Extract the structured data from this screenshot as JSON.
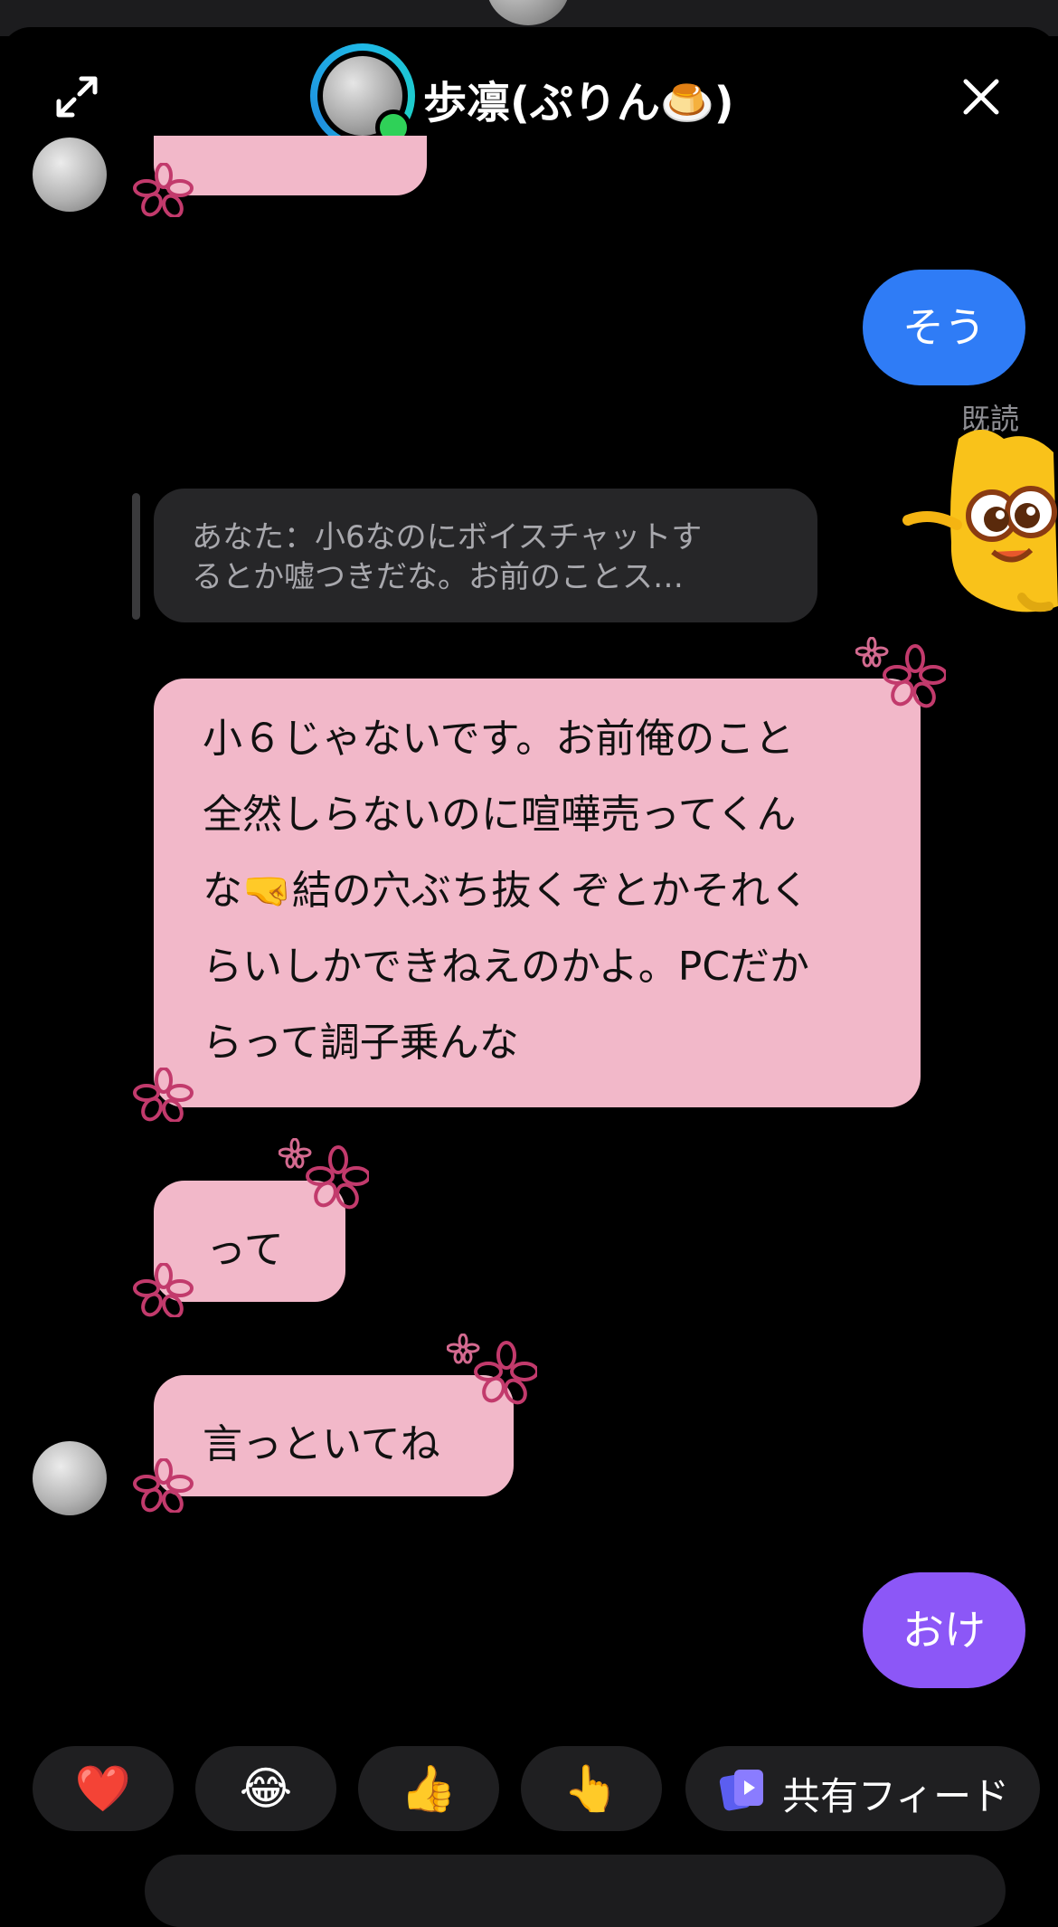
{
  "header": {
    "title": "歩凛(ぷりん🍮)"
  },
  "messages": {
    "sent_1": "そう",
    "read_receipt": "既読",
    "reply_preview": {
      "line1": "あなた：小6なのにボイスチャットす",
      "line2": "るとか嘘つきだな。お前のことス…"
    },
    "received_long": {
      "line1": "小６じゃないです。お前俺のこと",
      "line2": "全然しらないのに喧嘩売ってくん",
      "line3": "な🤜結の穴ぶち抜くぞとかそれく",
      "line4": "らいしかできねえのかよ。PCだか",
      "line5": "らって調子乗んな"
    },
    "received_short_1": "って",
    "received_short_2": "言っといてね",
    "sent_2": "おけ"
  },
  "reactions": {
    "heart": "❤️",
    "laugh": "😂",
    "thumbs": "👍",
    "point": "👆",
    "feed_label": "共有フィード"
  },
  "colors": {
    "blue_bubble": "#2f7cf6",
    "purple_bubble": "#8c57f7",
    "pink_bubble": "#f2b8c9",
    "online": "#2fd158"
  }
}
